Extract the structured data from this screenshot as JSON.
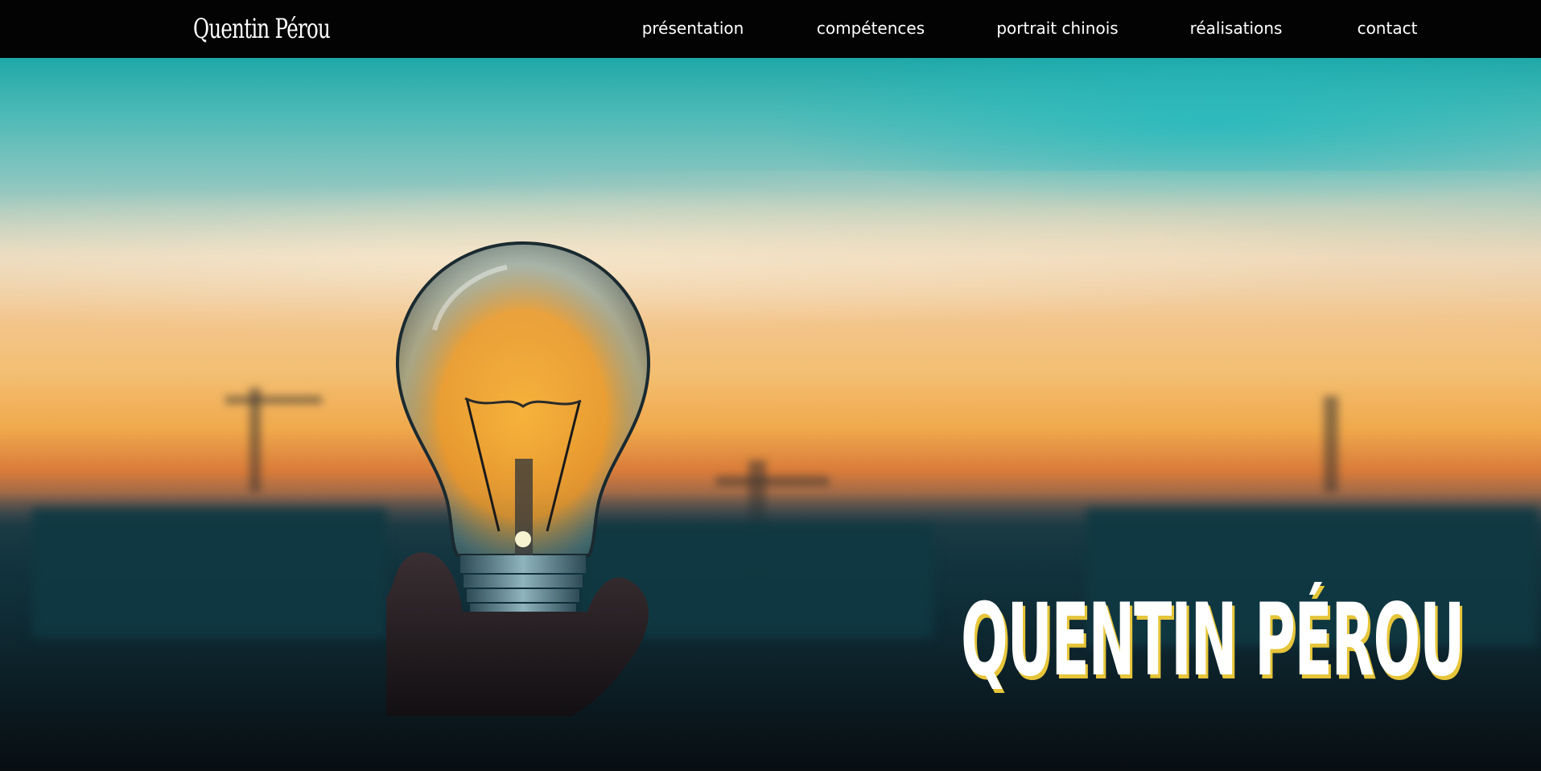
{
  "header": {
    "logo": "Quentin Pérou",
    "nav": [
      {
        "label": "présentation"
      },
      {
        "label": "compétences"
      },
      {
        "label": "portrait chinois"
      },
      {
        "label": "réalisations"
      },
      {
        "label": "contact"
      }
    ]
  },
  "hero": {
    "title": "QUENTIN PÉROU",
    "image": "lightbulb-sunset-image",
    "title_shadow_color": "#e6c53a"
  },
  "colors": {
    "nav_background": "#030303",
    "nav_text": "#ffffff",
    "accent": "#e6c53a"
  }
}
